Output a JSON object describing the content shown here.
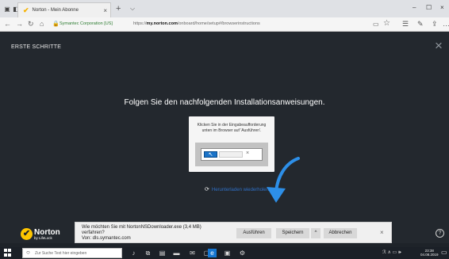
{
  "browser": {
    "tab_title": "Norton - Mein Abonne",
    "tab_close": "×",
    "new_tab": "+",
    "tab_dropdown": "⌵",
    "minimize": "–",
    "maximize": "☐",
    "close": "×",
    "back": "←",
    "forward": "→",
    "refresh": "↻",
    "home": "⌂",
    "cert_label": "Symantec Corporation [US]",
    "url_prefix": "https://",
    "url_domain": "my.norton.com",
    "url_path": "/onboard/home/setup#/browserinstructions"
  },
  "page": {
    "section_title": "ERSTE SCHRITTE",
    "close_glyph": "×",
    "main_heading": "Folgen Sie den nachfolgenden Installationsanweisungen.",
    "card_text_line1": "Klicken Sie in der Eingabeaufforderung",
    "card_text_line2": "unten im Browser auf 'Ausführen'.",
    "restart_download": "Herunterladen wiederholen",
    "logo_word": "Norton",
    "logo_sub": "by LifeLock",
    "help_glyph": "?"
  },
  "download_bar": {
    "line1": "Wie möchten Sie mit NortonNSDownloader.exe (3,4 MB)",
    "line2": "verfahren?",
    "line3": "Von: dls.symantec.com",
    "run": "Ausführen",
    "save": "Speichern",
    "more": "^",
    "cancel": "Abbrechen",
    "close": "×"
  },
  "taskbar": {
    "search_placeholder": "Zur Suche Text hier eingeben",
    "time": "23:38",
    "date": "04.08.2019"
  },
  "colors": {
    "page_bg": "#23282e",
    "accent_blue": "#1a73c8",
    "norton_yellow": "#ffc600"
  }
}
